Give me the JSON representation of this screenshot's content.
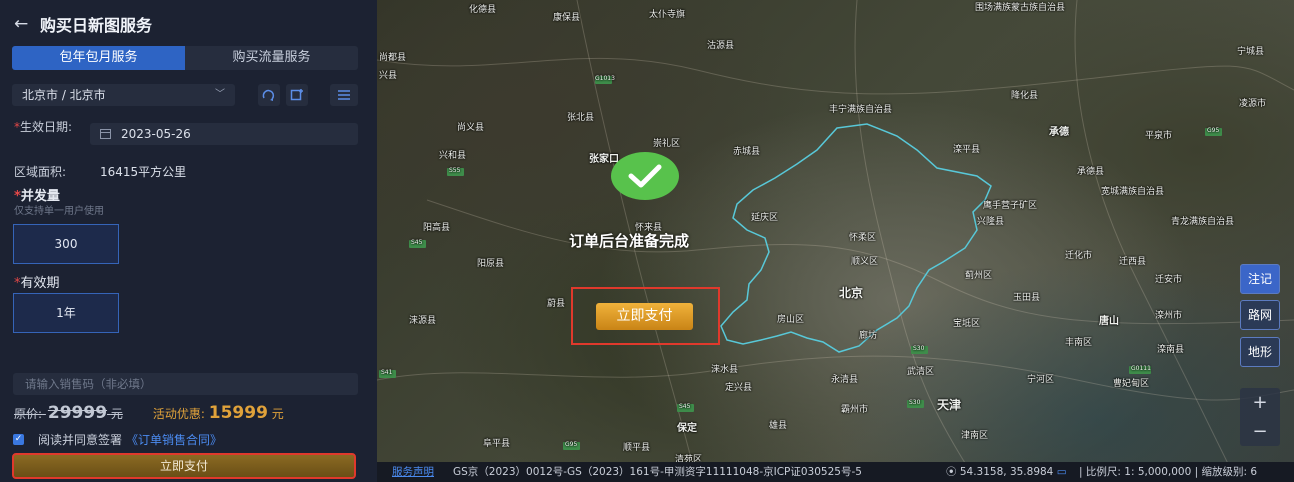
{
  "panel": {
    "title": "购买日新图服务",
    "tabs": [
      "包年包月服务",
      "购买流量服务"
    ],
    "region": "北京市 / 北京市",
    "date_label": "生效日期:",
    "date_value": "2023-05-26",
    "area_label": "区域面积:",
    "area_value": "16415平方公里",
    "concurrency_label": "并发量",
    "concurrency_hint": "仅支持单一用户使用",
    "concurrency_value": "300",
    "validity_label": "有效期",
    "validity_value": "1年",
    "sales_code_placeholder": "请输入销售码（非必填）",
    "orig_label": "原价:",
    "orig_value": "29999",
    "orig_unit": "元",
    "promo_label": "活动优惠:",
    "promo_value": "15999",
    "promo_unit": "元",
    "agree_text": "阅读并同意签署",
    "contract_link": "《订单销售合同》",
    "pay_button": "立即支付"
  },
  "map": {
    "places": [
      "化德县",
      "康保县",
      "太仆寺旗",
      "围场满族蒙古族自治县",
      "尚都县",
      "沽源县",
      "兴县",
      "宁城县",
      "降化县",
      "凌源市",
      "丰宁满族自治县",
      "尚义县",
      "张北县",
      "崇礼区",
      "承德",
      "平泉市",
      "兴和县",
      "张家口",
      "赤城县",
      "滦平县",
      "承德县",
      "宽城满族自治县",
      "延庆区",
      "鹰手营子矿区",
      "兴隆县",
      "青龙满族自治县",
      "阳高县",
      "怀来县",
      "怀柔区",
      "迁化市",
      "迁西县",
      "阳原县",
      "顺义区",
      "蓟州区",
      "迁安市",
      "蔚县",
      "北京",
      "玉田县",
      "涞源县",
      "房山区",
      "廊坊",
      "宝坻区",
      "唐山",
      "滦州市",
      "丰南区",
      "涞水县",
      "滦南县",
      "定兴县",
      "永清县",
      "武清区",
      "宁河区",
      "曹妃甸区",
      "霸州市",
      "天津",
      "阜平县",
      "保定",
      "雄县",
      "顺平县",
      "清苑区",
      "津南区"
    ],
    "road_shields": [
      "G1013",
      "S41",
      "S55",
      "S45",
      "G95",
      "S30",
      "S45",
      "S30",
      "G0111",
      "G95"
    ],
    "order_ready": "订单后台准备完成",
    "pay_button": "立即支付",
    "layer_buttons": [
      "注记",
      "路网",
      "地形"
    ],
    "zoom_in": "+",
    "zoom_out": "−",
    "status": {
      "disclaimer": "服务声明",
      "gs": "GS京（2023）0012号-GS（2023）161号-甲测资字11111048-京ICP证030525号-5",
      "coord": "54.3158, 35.8984",
      "scale": "比例尺: 1: 5,000,000",
      "zoom_level": "缩放级别: 6"
    }
  },
  "colors": {
    "accent": "#2e64c4",
    "boundary": "#58c8d8",
    "promo": "#e0a23a",
    "success": "#58c24c",
    "highlight": "#e0392c"
  }
}
